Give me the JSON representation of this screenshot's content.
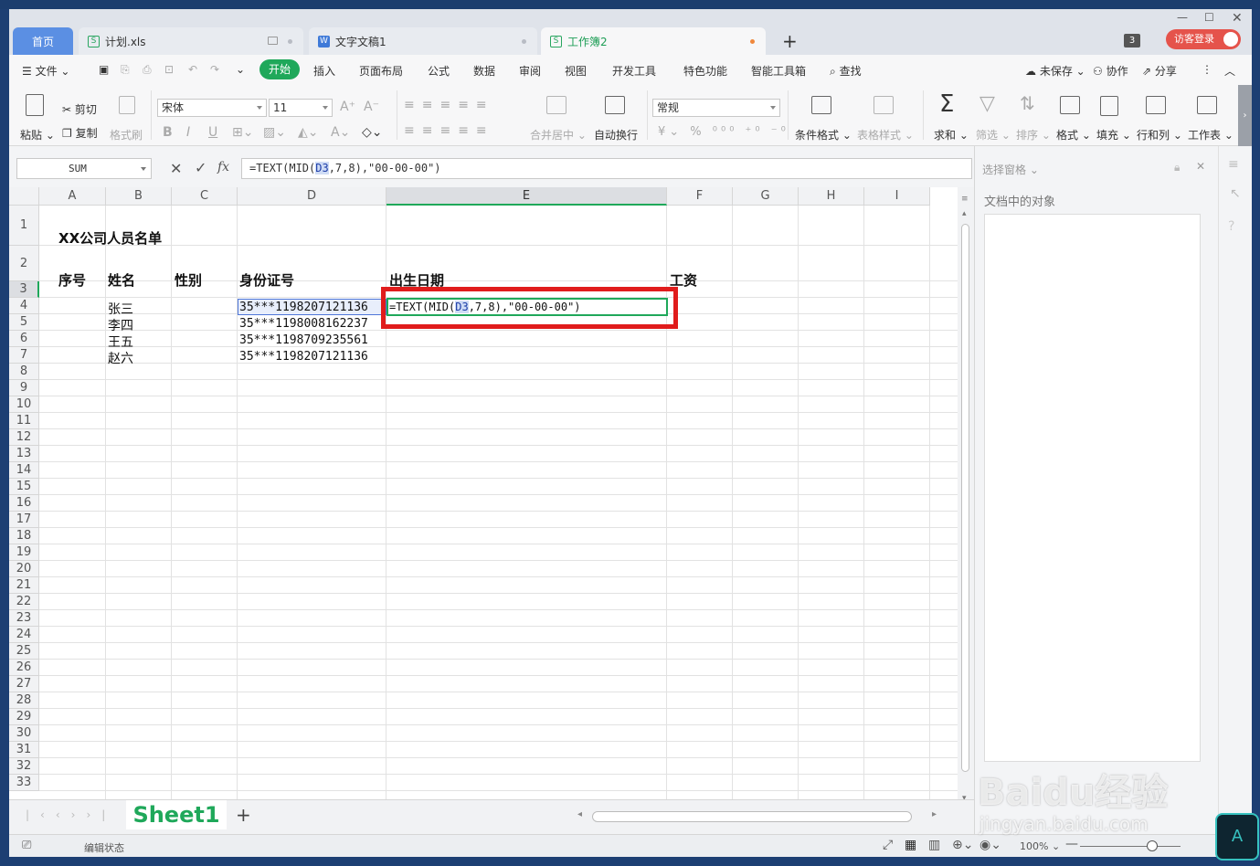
{
  "tabs": {
    "home": "首页",
    "doc1": "计划.xls",
    "doc2": "文字文稿1",
    "doc3": "工作簿2",
    "count": "3",
    "login": "访客登录"
  },
  "menu": {
    "file": "文件",
    "start": "开始",
    "insert": "插入",
    "layout": "页面布局",
    "formula": "公式",
    "data": "数据",
    "review": "审阅",
    "view": "视图",
    "dev": "开发工具",
    "special": "特色功能",
    "smart": "智能工具箱",
    "find": "查找",
    "unsaved": "未保存",
    "collab": "协作",
    "share": "分享"
  },
  "ribbon": {
    "paste": "粘贴",
    "cut": "剪切",
    "copy": "复制",
    "format_painter": "格式刷",
    "font_name": "宋体",
    "font_size": "11",
    "merge": "合并居中",
    "wrap": "自动换行",
    "number_format": "常规",
    "cond_format": "条件格式",
    "table_style": "表格样式",
    "sum": "求和",
    "filter": "筛选",
    "sort": "排序",
    "format": "格式",
    "fill": "填充",
    "rowcol": "行和列",
    "sheet": "工作表"
  },
  "formula_bar": {
    "name_box": "SUM",
    "fx": "fx",
    "formula_pre": "=TEXT(MID(",
    "formula_ref": "D3",
    "formula_post": ",7,8),\"00-00-00\")"
  },
  "sheet": {
    "columns": [
      "A",
      "B",
      "C",
      "D",
      "E",
      "F",
      "G",
      "H",
      "I"
    ],
    "rows": [
      "1",
      "2",
      "3",
      "4",
      "5",
      "6",
      "7",
      "8",
      "9",
      "10",
      "11",
      "12",
      "13",
      "14",
      "15",
      "16",
      "17",
      "18",
      "19",
      "20",
      "21",
      "22",
      "23",
      "24",
      "25",
      "26",
      "27",
      "28",
      "29",
      "30",
      "31",
      "32",
      "33"
    ],
    "title": "XX公司人员名单",
    "headers": {
      "seq": "序号",
      "name": "姓名",
      "gender": "性别",
      "id": "身份证号",
      "birth": "出生日期",
      "salary": "工资"
    },
    "names": [
      "张三",
      "李四",
      "王五",
      "赵六"
    ],
    "ids": [
      "35***1198207121136",
      "35***1198008162237",
      "35***1198709235561",
      "35***1198207121136"
    ],
    "edit_pre": "=TEXT(MID(",
    "edit_ref": "D3",
    "edit_post": ",7,8),\"00-00-00\")",
    "sheet_tab": "Sheet1"
  },
  "panel": {
    "title": "选择窗格",
    "subtitle": "文档中的对象"
  },
  "status": {
    "mode": "编辑状态",
    "zoom": "100%"
  },
  "watermark": {
    "brand": "Baidu经验",
    "url": "jingyan.baidu.com"
  },
  "ime": "A"
}
